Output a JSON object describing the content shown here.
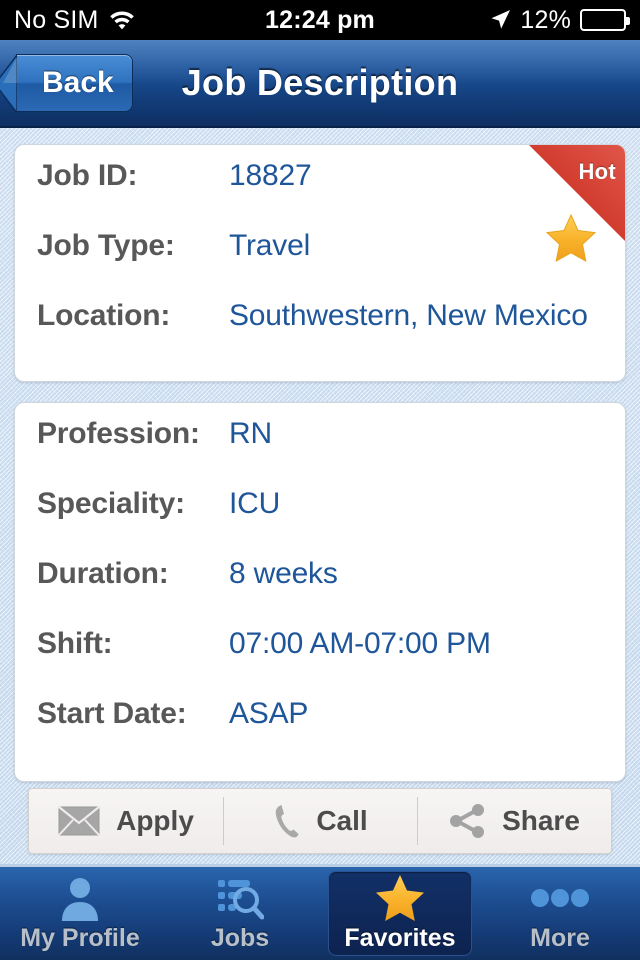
{
  "status_bar": {
    "carrier": "No SIM",
    "wifi_icon": "wifi-icon",
    "time": "12:24 pm",
    "location_icon": "location-arrow-icon",
    "battery_percent": "12%",
    "battery_level": 12,
    "battery_color": "#e8291e"
  },
  "navbar": {
    "back_label": "Back",
    "title": "Job Description"
  },
  "job_summary": {
    "badge": "Hot",
    "badge_color": "#d0392c",
    "favorite_icon": "star-icon",
    "rows": [
      {
        "label": "Job ID:",
        "value": "18827"
      },
      {
        "label": "Job Type:",
        "value": "Travel"
      },
      {
        "label": "Location:",
        "value": "Southwestern, New Mexico"
      }
    ]
  },
  "job_details": {
    "rows": [
      {
        "label": "Profession:",
        "value": "RN"
      },
      {
        "label": "Speciality:",
        "value": "ICU"
      },
      {
        "label": "Duration:",
        "value": "8 weeks"
      },
      {
        "label": "Shift:",
        "value": "07:00 AM-07:00 PM"
      },
      {
        "label": "Start Date:",
        "value": "ASAP"
      }
    ]
  },
  "actions": [
    {
      "label": "Apply",
      "icon": "envelope-icon"
    },
    {
      "label": "Call",
      "icon": "phone-icon"
    },
    {
      "label": "Share",
      "icon": "share-icon"
    }
  ],
  "tabbar": {
    "items": [
      {
        "label": "My Profile",
        "icon": "person-icon",
        "selected": false
      },
      {
        "label": "Jobs",
        "icon": "job-search-icon",
        "selected": false
      },
      {
        "label": "Favorites",
        "icon": "star-icon",
        "selected": true
      },
      {
        "label": "More",
        "icon": "ellipsis-icon",
        "selected": false
      }
    ]
  },
  "colors": {
    "value_blue": "#1f5699",
    "label_gray": "#585858",
    "accent_navy": "#1d5298",
    "star_gold": "#f9b429"
  }
}
